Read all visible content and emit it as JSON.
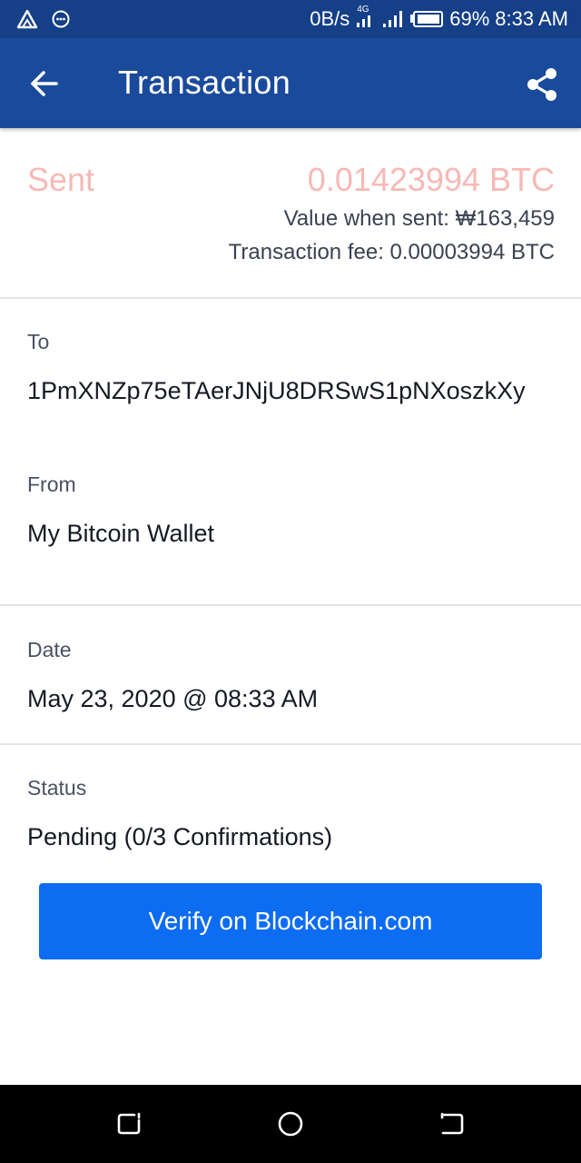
{
  "status_bar": {
    "speed": "0B/s",
    "network_type": "4G",
    "battery": "69%",
    "time": "8:33 AM",
    "icons": [
      "alert-triangle-icon",
      "circle-dots-icon",
      "signal-icon",
      "signal-icon",
      "battery-icon"
    ]
  },
  "header": {
    "title": "Transaction",
    "back_icon": "arrow-left-icon",
    "share_icon": "share-icon"
  },
  "summary": {
    "direction": "Sent",
    "amount": "0.01423994 BTC",
    "value_when_sent": "Value when sent: ₩163,459",
    "transaction_fee": "Transaction fee: 0.00003994 BTC"
  },
  "details": {
    "to_label": "To",
    "to_value": "1PmXNZp75eTAerJNjU8DRSwS1pNXoszkXy",
    "from_label": "From",
    "from_value": "My Bitcoin Wallet",
    "date_label": "Date",
    "date_value": "May 23, 2020 @ 08:33 AM",
    "status_label": "Status",
    "status_value": "Pending (0/3 Confirmations)"
  },
  "actions": {
    "verify_label": "Verify on Blockchain.com"
  },
  "colors": {
    "status_bar": "#153f87",
    "app_bar": "#1a4a9b",
    "sent_text": "#f7b9b6",
    "button": "#0c6cf2"
  }
}
